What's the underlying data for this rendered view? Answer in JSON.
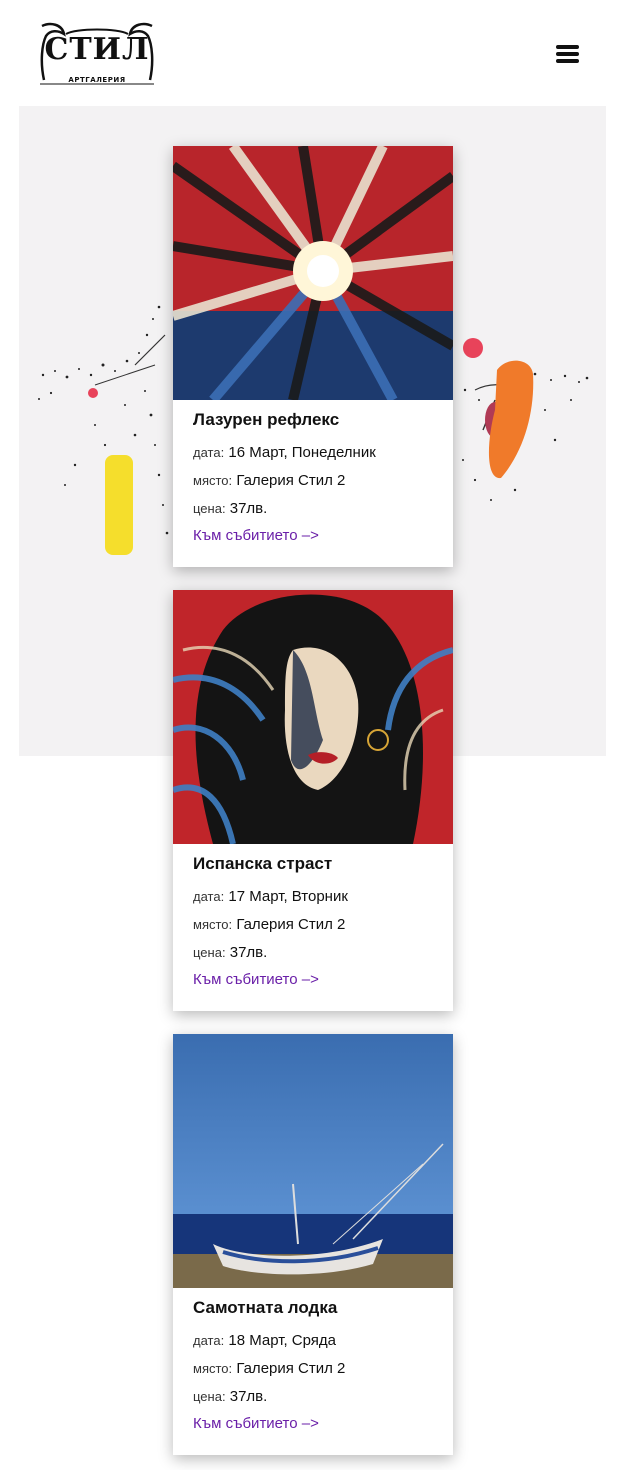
{
  "header": {
    "logo_word": "СТИЛ",
    "logo_sub": "АРТГАЛЕРИЯ",
    "menu_icon": "hamburger-menu-icon"
  },
  "labels": {
    "date": "дата:",
    "place": "място:",
    "price": "цена:"
  },
  "events": [
    {
      "title": "Лазурен рефлекс",
      "date": "16 Март, Понеделник",
      "place": "Галерия Стил 2",
      "price": "37лв.",
      "link": "Към събитието –>"
    },
    {
      "title": "Испанска страст",
      "date": "17 Март, Вторник",
      "place": "Галерия Стил 2",
      "price": "37лв.",
      "link": "Към събитието –>"
    },
    {
      "title": "Самотната лодка",
      "date": "18 Март, Сряда",
      "place": "Галерия Стил 2",
      "price": "37лв.",
      "link": "Към събитието –>"
    }
  ],
  "colors": {
    "link": "#6a1fa8",
    "hero_bg": "#f3f2f3"
  }
}
